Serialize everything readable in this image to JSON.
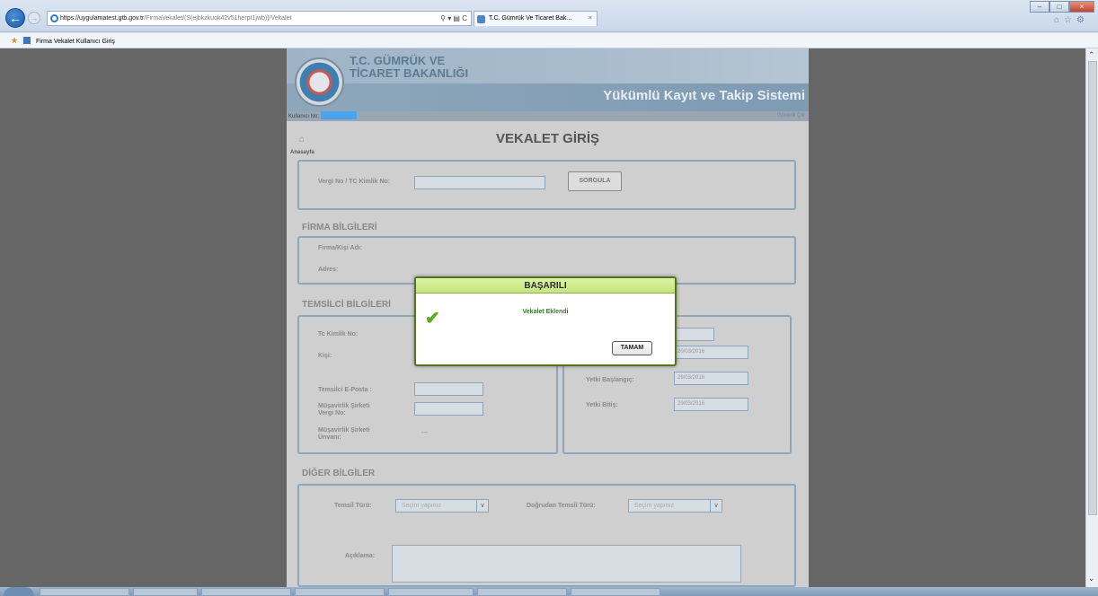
{
  "browser": {
    "url_prefix": "https://",
    "url_host": "uygulamatest.gtb.gov.tr",
    "url_path": "/FirmaVekalet/(S(ejbkzkuok42v51herpt1jwb))/Vekalet",
    "tab_title": "T.C. Gümrük Ve Ticaret Bak...",
    "favorite_item": "Firma Vekalet Kullanıcı Giriş"
  },
  "header": {
    "org_line1": "T.C. GÜMRÜK VE",
    "org_line2": "TİCARET BAKANLIĞI",
    "system_name": "Yükümlü Kayıt ve Takip Sistemi",
    "user_label": "Kullanıcı No:",
    "right_link": "Güvenli Çık"
  },
  "page": {
    "home_label": "Anasayfa",
    "title": "VEKALET GİRİŞ"
  },
  "search": {
    "label": "Vergi No / TC Kimlik No:",
    "button": "SORGULA"
  },
  "company": {
    "section": "FİRMA BİLGİLERİ",
    "name_label": "Firma/Kişi Adı:",
    "address_label": "Adres:"
  },
  "representative": {
    "section": "TEMSİLCİ BİLGİLERİ",
    "tc_label": "Tc Kimlik No:",
    "person_label": "Kişi:",
    "email_label": "Temsilci E-Posta :",
    "firm_tax_label": "Müşavirlik Şirketi Vergi No:",
    "firm_title_label": "Müşavirlik Şirketi Ünvanı:",
    "firm_title_value": "---"
  },
  "authority": {
    "section_tail": "Rİ",
    "date1": "20/03/2016",
    "start_label": "Yetki Başlangıç:",
    "start_value": "29/03/2016",
    "end_label": "Yetki Bitiş:",
    "end_value": "29/03/2016"
  },
  "other": {
    "section": "DİĞER BİLGİLER",
    "type_label": "Temsil Türü:",
    "type_value": "Seçim yapınız",
    "direct_label": "Doğrudan Temsil Türü:",
    "direct_value": "Seçim yapınız",
    "desc_label": "Açıklama:"
  },
  "dialog": {
    "title": "BAŞARILI",
    "message": "Vekalet Eklendi",
    "ok_button": "TAMAM"
  },
  "colors": {
    "success_header": "#c5e47a",
    "success_border": "#54731e",
    "panel_border": "#8fa6bb"
  }
}
